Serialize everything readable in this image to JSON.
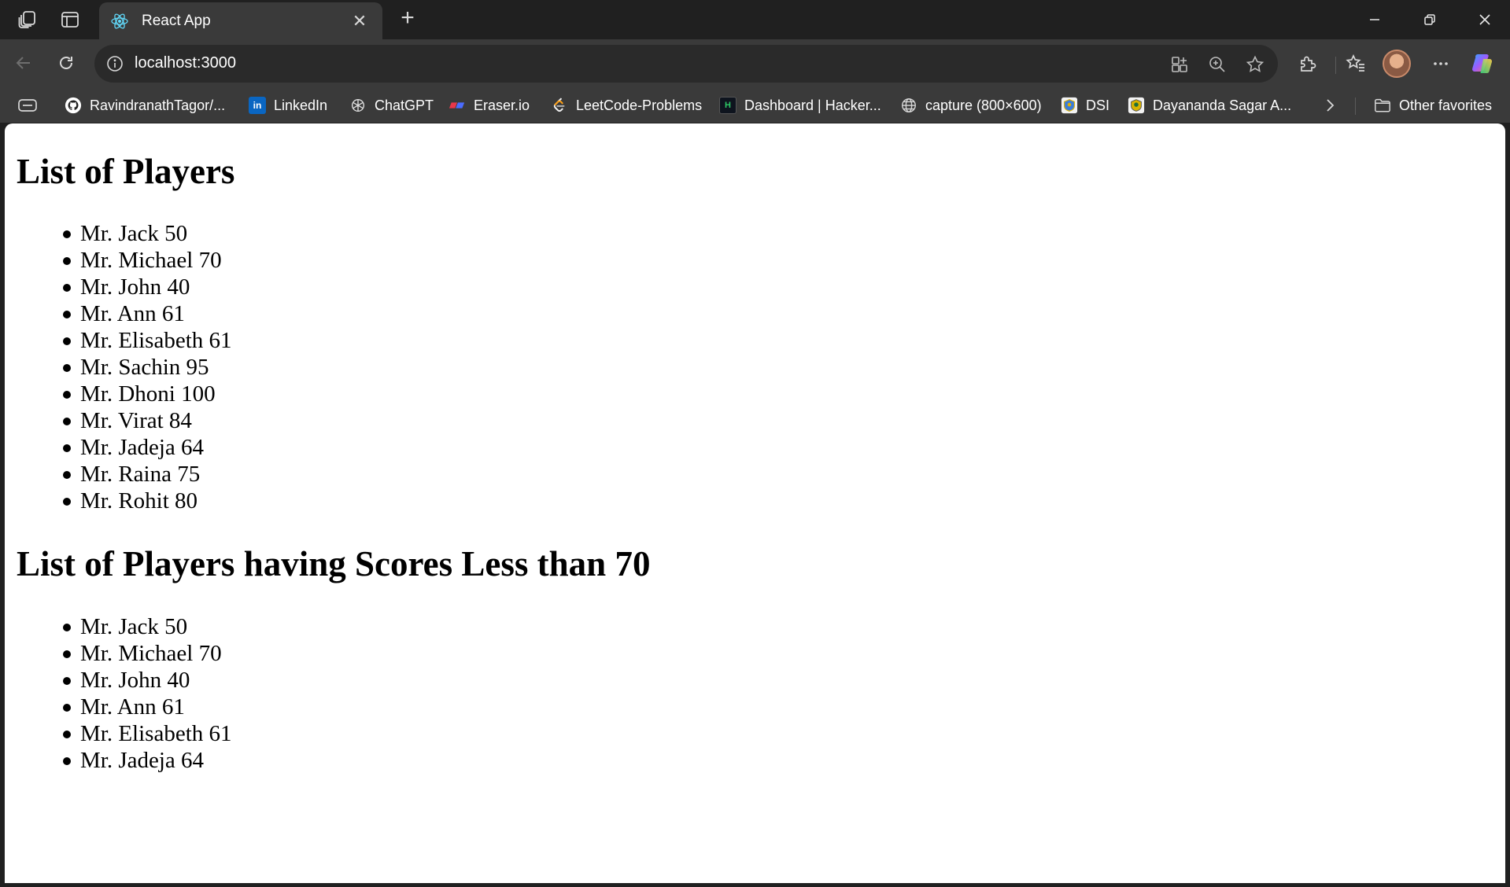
{
  "window": {
    "tab_title": "React App",
    "url": "localhost:3000"
  },
  "bookmarks": [
    {
      "label": "RavindranathTagor/...",
      "icon": "github-icon"
    },
    {
      "label": "LinkedIn",
      "icon": "linkedin-icon"
    },
    {
      "label": "ChatGPT",
      "icon": "chatgpt-icon"
    },
    {
      "label": "Eraser.io",
      "icon": "eraser-icon"
    },
    {
      "label": "LeetCode-Problems",
      "icon": "leetcode-icon"
    },
    {
      "label": "Dashboard | Hacker...",
      "icon": "hackerrank-icon"
    },
    {
      "label": "capture (800×600)",
      "icon": "globe-icon"
    },
    {
      "label": "DSI",
      "icon": "dsi-emblem-icon"
    },
    {
      "label": "Dayananda Sagar A...",
      "icon": "dsu-emblem-icon"
    }
  ],
  "other_favorites": "Other favorites",
  "page": {
    "heading_all": "List of Players",
    "players_all": [
      "Mr. Jack 50",
      "Mr. Michael 70",
      "Mr. John 40",
      "Mr. Ann 61",
      "Mr. Elisabeth 61",
      "Mr. Sachin 95",
      "Mr. Dhoni 100",
      "Mr. Virat 84",
      "Mr. Jadeja 64",
      "Mr. Raina 75",
      "Mr. Rohit 80"
    ],
    "heading_filtered": "List of Players having Scores Less than 70",
    "players_filtered": [
      "Mr. Jack 50",
      "Mr. Michael 70",
      "Mr. John 40",
      "Mr. Ann 61",
      "Mr. Elisabeth 61",
      "Mr. Jadeja 64"
    ]
  }
}
